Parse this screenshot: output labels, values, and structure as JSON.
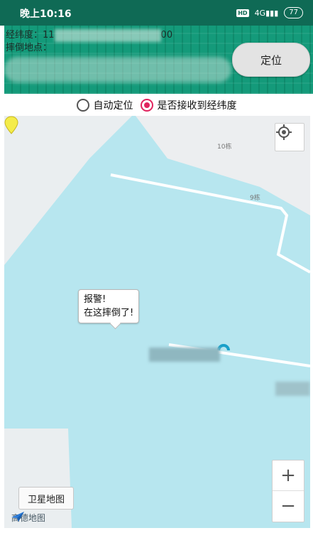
{
  "status_bar": {
    "time": "晚上10:16",
    "hd": "HD",
    "network": "4G",
    "battery": "77"
  },
  "header": {
    "coords_label": "经纬度：11",
    "coords_suffix": "00",
    "location_label": "摔倒地点：",
    "locate_button": "定位",
    "accent_color": "#0f8b6c"
  },
  "options": {
    "auto_locate": {
      "label": "自动定位",
      "checked": false
    },
    "received": {
      "label": "是否接收到经纬度",
      "checked": true
    },
    "radio_color": "#e0245e"
  },
  "map": {
    "building_labels": [
      "10栋",
      "9栋"
    ],
    "callout": {
      "line1": "报警!",
      "line2": "在这摔倒了!"
    },
    "satellite_button": "卫星地图",
    "logo_text": "高德地图",
    "zoom_in": "+",
    "zoom_out": "−",
    "water_color": "#b7e6ef",
    "icons": {
      "locate": "crosshair-icon",
      "marker": "map-pin-icon",
      "logo": "amap-logo-icon"
    }
  }
}
